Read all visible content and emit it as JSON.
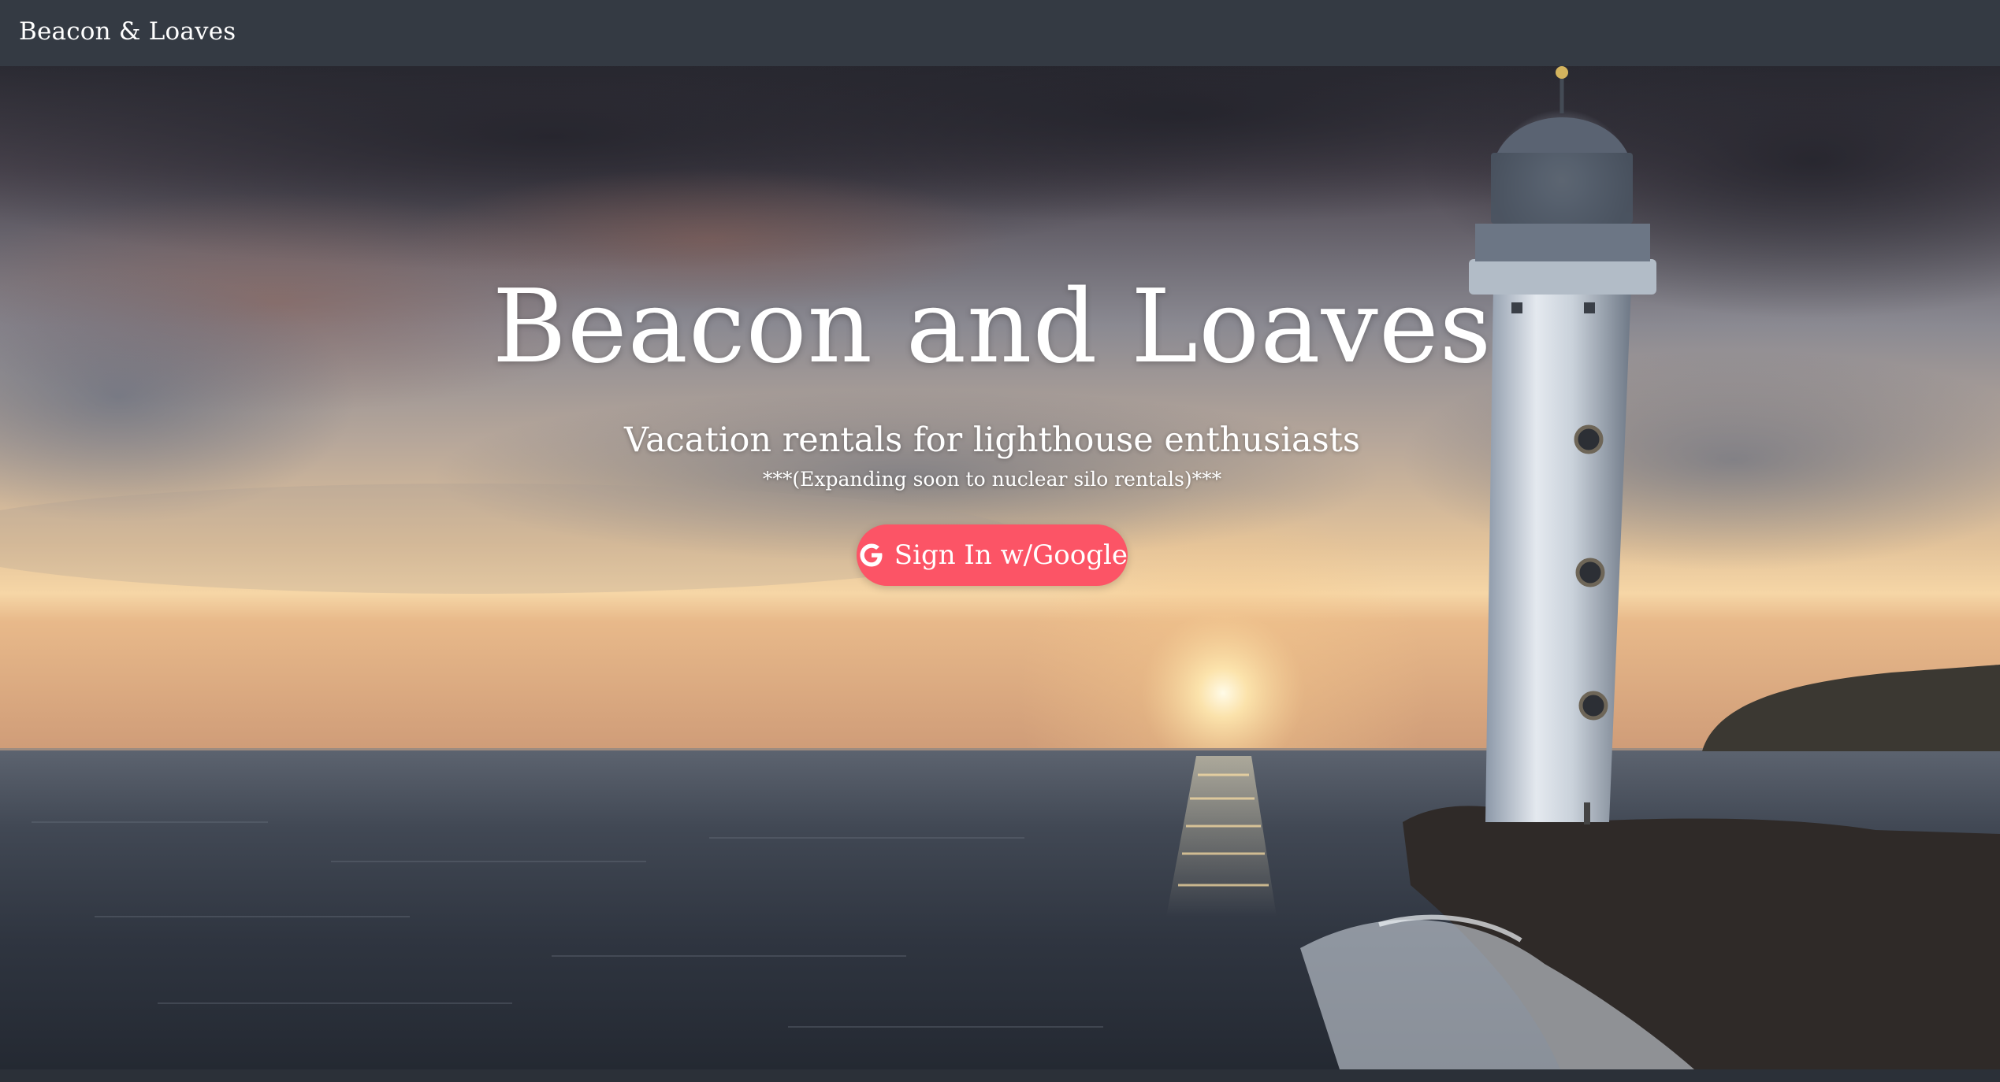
{
  "navbar": {
    "brand": "Beacon & Loaves"
  },
  "hero": {
    "title": "Beacon and Loaves",
    "subtitle": "Vacation rentals for lighthouse enthusiasts",
    "note": "***(Expanding soon to nuclear silo rentals)***",
    "signin_label": "Sign In w/Google",
    "signin_icon": "google-g-icon",
    "background_image": "lighthouse-at-sunset-photo"
  },
  "colors": {
    "navbar_bg": "#343a43",
    "button_bg": "#fc5466",
    "text": "#ffffff"
  }
}
